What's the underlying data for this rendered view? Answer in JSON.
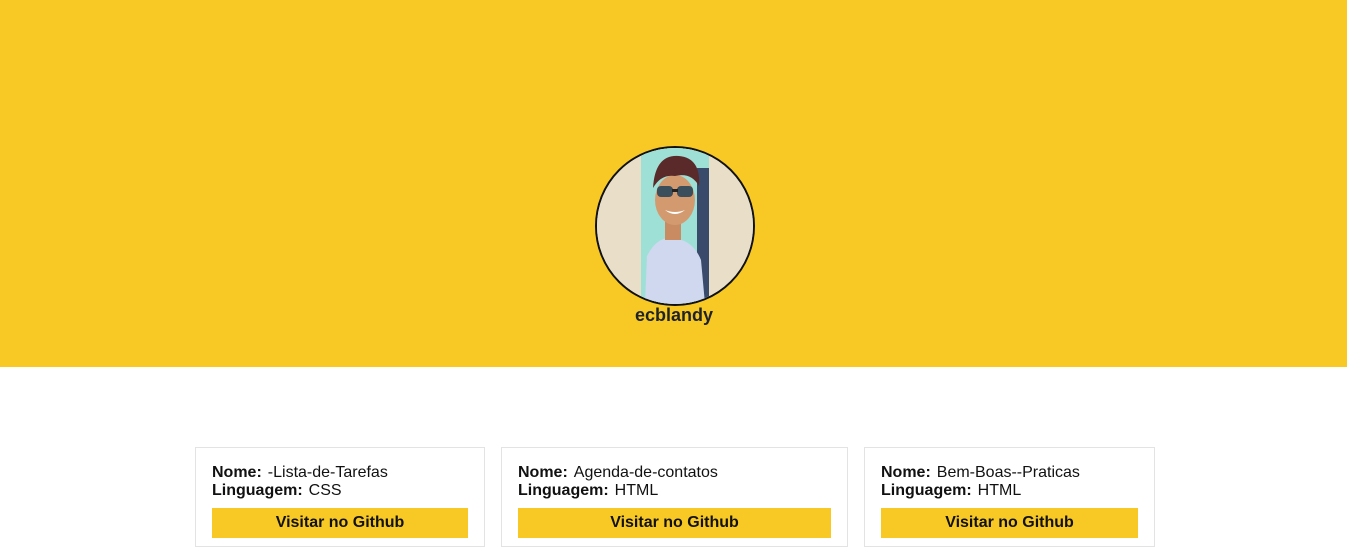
{
  "profile": {
    "username": "ecblandy"
  },
  "colors": {
    "accent": "#f8c924",
    "background": "#ffffff",
    "text": "#111111"
  },
  "repos": [
    {
      "name_label": "Nome:",
      "name": "-Lista-de-Tarefas",
      "lang_label": "Linguagem:",
      "language": "CSS",
      "button_label": "Visitar no Github"
    },
    {
      "name_label": "Nome:",
      "name": "Agenda-de-contatos",
      "lang_label": "Linguagem:",
      "language": "HTML",
      "button_label": "Visitar no Github"
    },
    {
      "name_label": "Nome:",
      "name": "Bem-Boas--Praticas",
      "lang_label": "Linguagem:",
      "language": "HTML",
      "button_label": "Visitar no Github"
    }
  ]
}
